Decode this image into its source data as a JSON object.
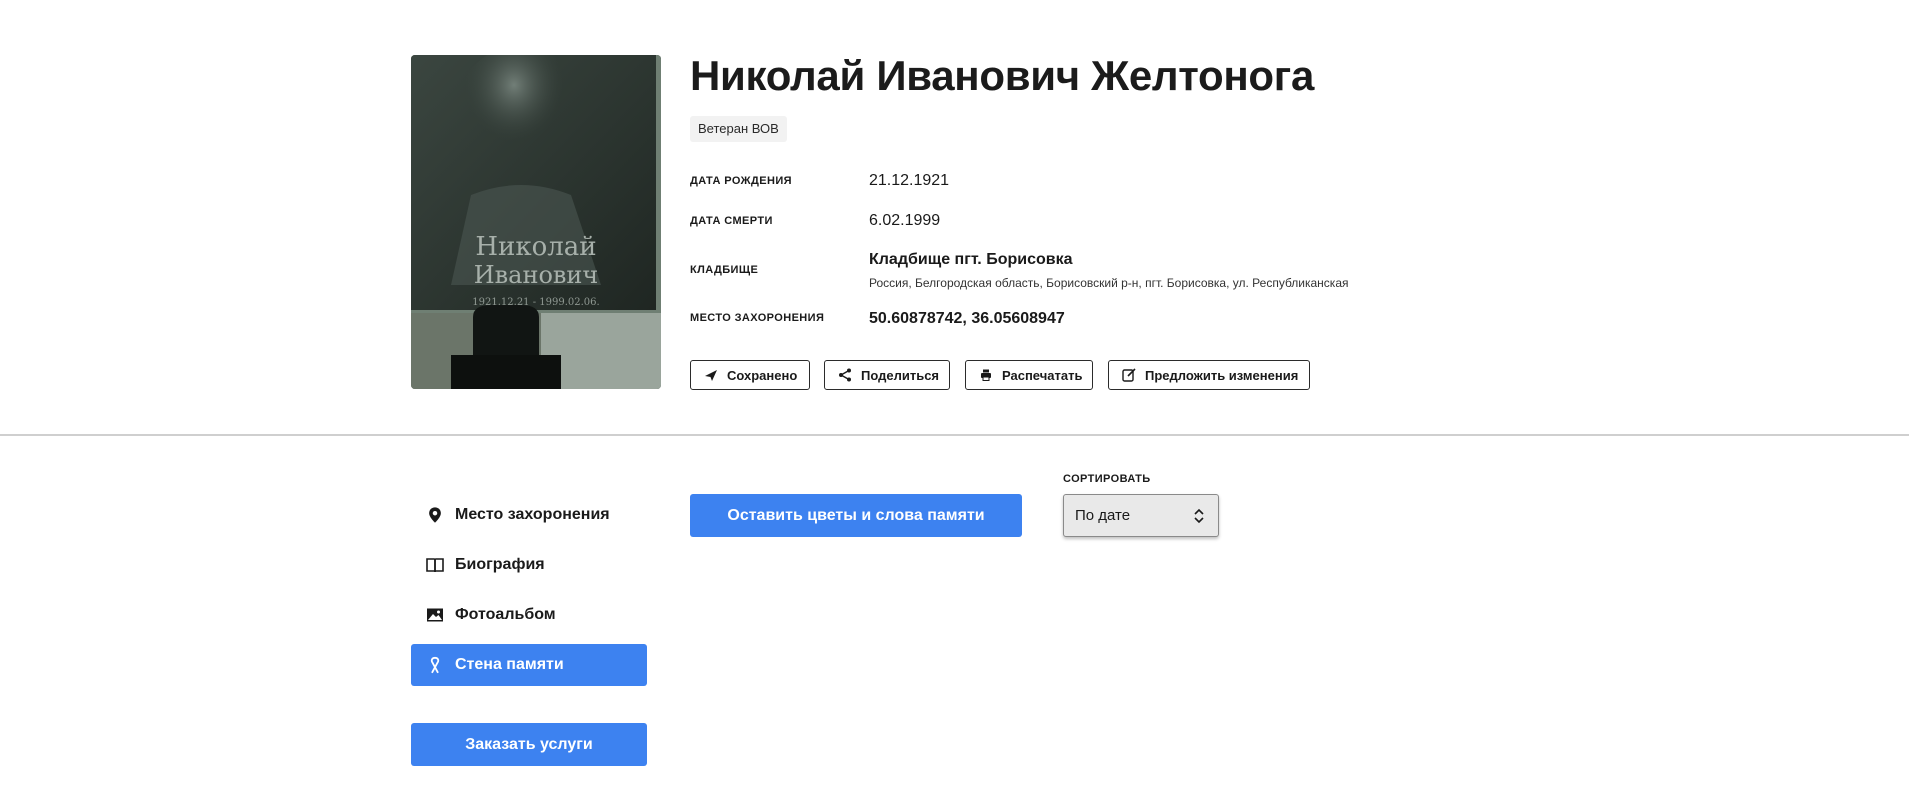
{
  "person": {
    "name": "Николай Иванович Желтонога",
    "badge": "Ветеран ВОВ"
  },
  "details": {
    "birth_label": "ДАТА РОЖДЕНИЯ",
    "birth_value": "21.12.1921",
    "death_label": "ДАТА СМЕРТИ",
    "death_value": "6.02.1999",
    "cemetery_label": "КЛАДБИЩЕ",
    "cemetery_name": "Кладбище пгт. Борисовка",
    "cemetery_address": "Россия, Белгородская область, Борисовский р-н, пгт. Борисовка, ул. Республиканская",
    "burial_label": "МЕСТО ЗАХОРОНЕНИЯ",
    "burial_coords": "50.60878742, 36.05608947"
  },
  "photo": {
    "engraving_line1": "Николай",
    "engraving_line2": "Иванович",
    "engraving_dates": "1921.12.21 - 1999.02.06."
  },
  "actions": {
    "saved": "Сохранено",
    "share": "Поделиться",
    "print": "Распечатать",
    "suggest": "Предложить изменения"
  },
  "sidebar": {
    "items": [
      {
        "label": "Место захоронения",
        "icon": "map-pin-icon"
      },
      {
        "label": "Биография",
        "icon": "book-icon"
      },
      {
        "label": "Фотоальбом",
        "icon": "image-icon"
      },
      {
        "label": "Стена памяти",
        "icon": "ribbon-icon",
        "active": true
      }
    ],
    "order_button": "Заказать услуги"
  },
  "memory_wall": {
    "leave_button": "Оставить цветы и слова памяти",
    "sort_label": "СОРТИРОВАТЬ",
    "sort_value": "По дате"
  },
  "colors": {
    "accent": "#3d82f0",
    "divider": "#cfcfcf"
  }
}
